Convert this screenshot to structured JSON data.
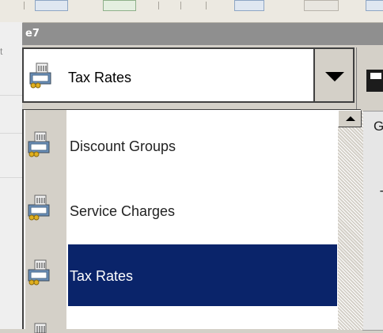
{
  "window": {
    "title": "e7",
    "background_text": "t"
  },
  "combo": {
    "selected_label": "Tax Rates",
    "icon": "ledger-icon",
    "dropdown_icon": "triangle-down-icon"
  },
  "list": {
    "items": [
      {
        "label": "Discount Groups",
        "icon": "ledger-icon",
        "selected": false
      },
      {
        "label": "Service Charges",
        "icon": "ledger-icon",
        "selected": false
      },
      {
        "label": "Tax Rates",
        "icon": "ledger-icon",
        "selected": true
      }
    ],
    "scroll_up_icon": "triangle-up-icon"
  },
  "right_panel": {
    "save_icon": "floppy-disk-icon",
    "tab_text": "G",
    "field_text": "T"
  },
  "colors": {
    "selection": "#0a246a",
    "titlebar": "#8f8f8f",
    "chrome": "#d4d0c8"
  }
}
